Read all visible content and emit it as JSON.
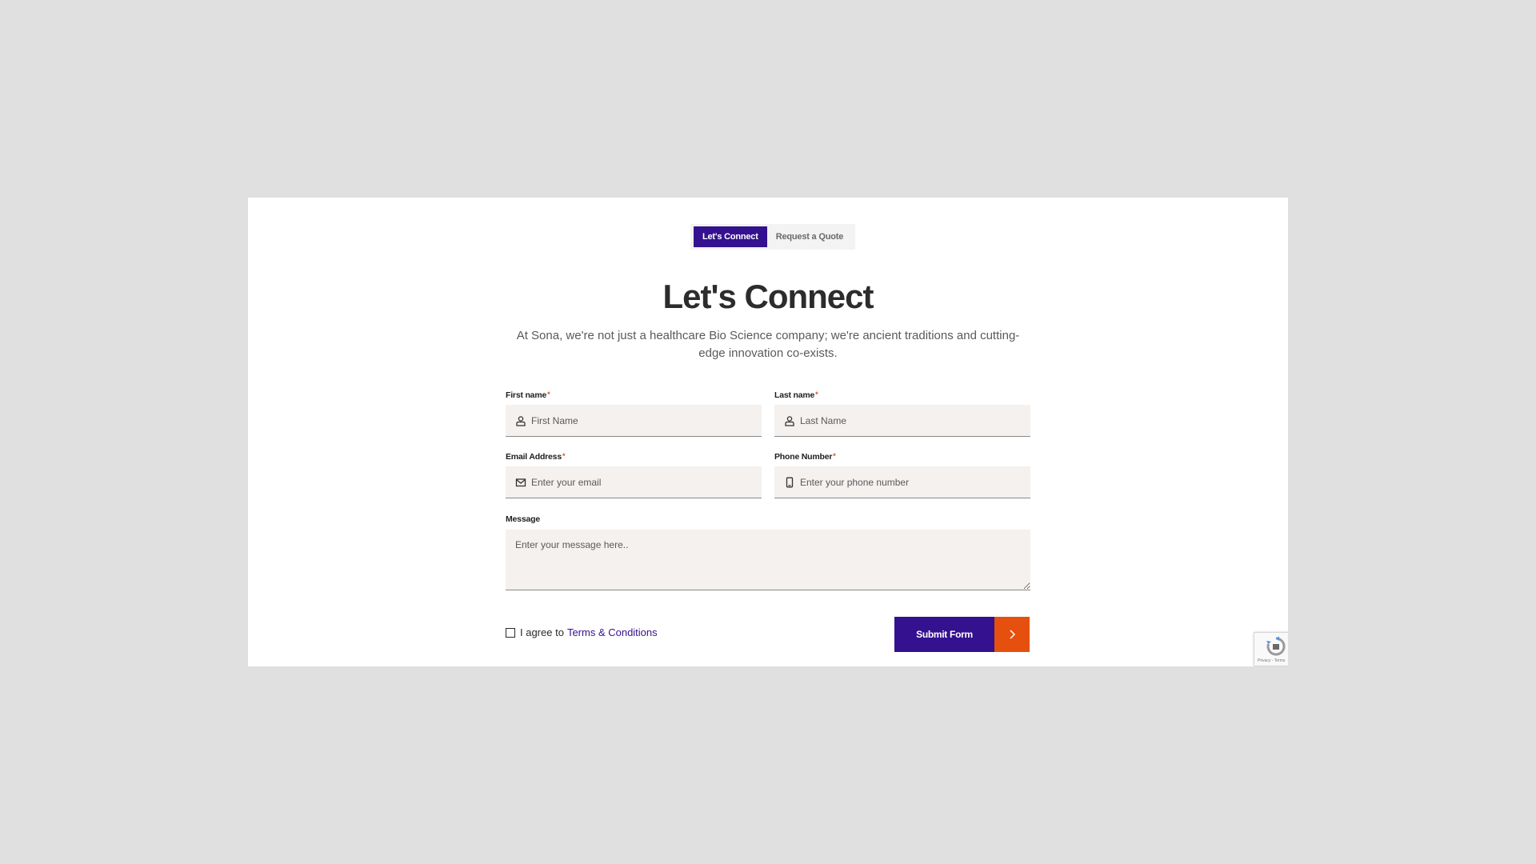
{
  "tabs": [
    {
      "label": "Let's Connect",
      "active": true
    },
    {
      "label": "Request a Quote",
      "active": false
    }
  ],
  "heading": "Let's Connect",
  "subtitle": "At Sona, we're not just a healthcare Bio Science company; we're ancient traditions and cutting-edge innovation co-exists.",
  "form": {
    "first_name": {
      "label": "First name",
      "required": "*",
      "placeholder": "First Name",
      "icon": "user-icon"
    },
    "last_name": {
      "label": "Last name",
      "required": "*",
      "placeholder": "Last Name",
      "icon": "user-icon"
    },
    "email": {
      "label": "Email Address",
      "required": "*",
      "placeholder": "Enter your email",
      "icon": "mail-icon"
    },
    "phone": {
      "label": "Phone Number",
      "required": "*",
      "placeholder": "Enter your phone number",
      "icon": "phone-icon"
    },
    "message": {
      "label": "Message",
      "placeholder": "Enter your message here.."
    }
  },
  "agree": {
    "prefix": "I agree to",
    "link": "Terms & Conditions"
  },
  "submit": {
    "label": "Submit Form",
    "icon": "chevron-right-icon"
  },
  "recaptcha": {
    "icon": "recaptcha-icon",
    "footer": "Privacy - Terms"
  },
  "colors": {
    "primary": "#34118e",
    "accent": "#e6500f",
    "background": "#e0e0e0",
    "field_bg": "#f4f1ef"
  }
}
